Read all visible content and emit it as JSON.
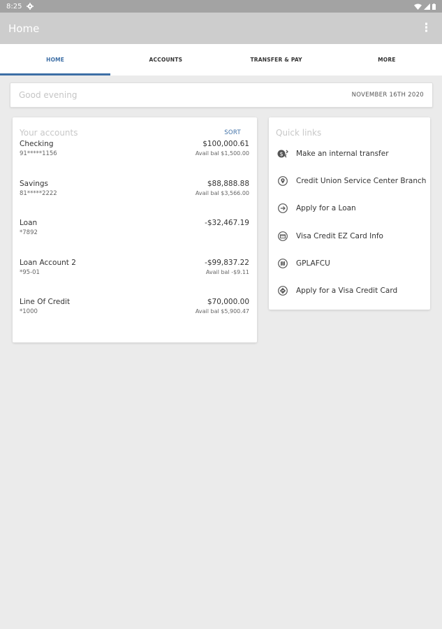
{
  "status_bar": {
    "time": "8:25"
  },
  "app_bar": {
    "title": "Home"
  },
  "tabs": [
    {
      "label": "HOME",
      "active": true
    },
    {
      "label": "ACCOUNTS",
      "active": false
    },
    {
      "label": "TRANSFER & PAY",
      "active": false
    },
    {
      "label": "MORE",
      "active": false
    }
  ],
  "greeting": {
    "text": "Good evening",
    "date": "NOVEMBER 16TH 2020"
  },
  "accounts": {
    "title": "Your accounts",
    "sort_label": "SORT",
    "items": [
      {
        "name": "Checking",
        "number": "91*****1156",
        "balance": "$100,000.61",
        "avail": "Avail bal $1,500.00"
      },
      {
        "name": "Savings",
        "number": "81*****2222",
        "balance": "$88,888.88",
        "avail": "Avail bal $3,566.00"
      },
      {
        "name": "Loan",
        "number": "*7892",
        "balance": "-$32,467.19",
        "avail": ""
      },
      {
        "name": "Loan Account 2",
        "number": "*95-01",
        "balance": "-$99,837.22",
        "avail": "Avail bal -$9.11"
      },
      {
        "name": "Line Of Credit",
        "number": "*1000",
        "balance": "$70,000.00",
        "avail": "Avail bal $5,900.47"
      }
    ]
  },
  "quick_links": {
    "title": "Quick links",
    "items": [
      {
        "label": "Make an internal transfer",
        "icon": "transfer-icon"
      },
      {
        "label": "Credit Union Service Center Branch",
        "icon": "location-pin-icon"
      },
      {
        "label": "Apply for a Loan",
        "icon": "arrow-right-circle-icon"
      },
      {
        "label": "Visa Credit EZ Card Info",
        "icon": "credit-card-icon"
      },
      {
        "label": "GPLAFCU",
        "icon": "map-icon"
      },
      {
        "label": "Apply for a Visa Credit Card",
        "icon": "directions-icon"
      }
    ]
  },
  "colors": {
    "accent": "#3e6fa6",
    "app_bar": "#cdcdcd",
    "status_bar": "#a3a3a3",
    "background": "#ebebeb"
  }
}
